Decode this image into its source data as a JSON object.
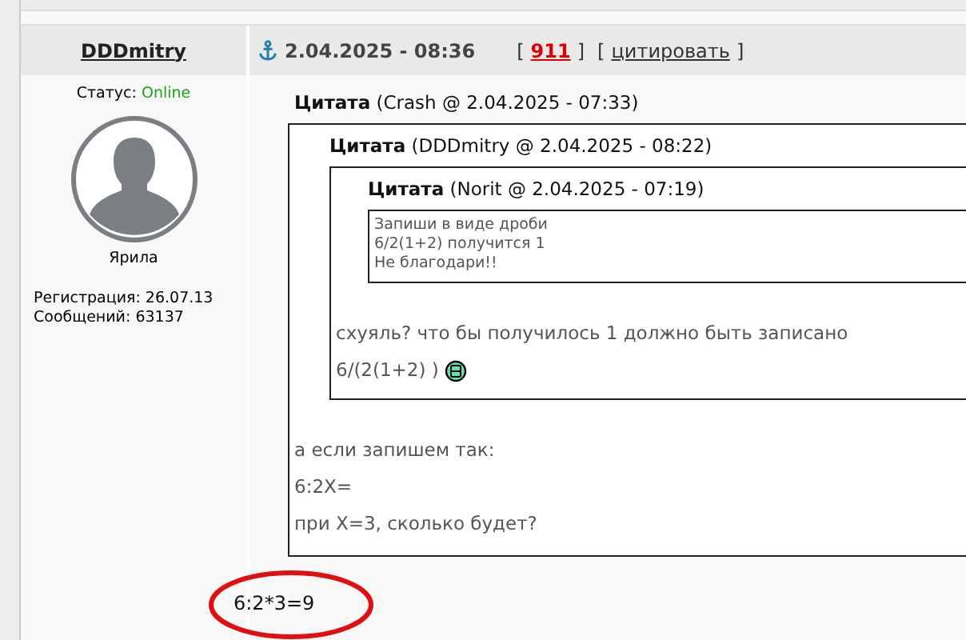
{
  "post": {
    "author": "DDDmitry",
    "date": "2.04.2025 - 08:36",
    "post_number": "911",
    "bracket_open": "[",
    "bracket_close": "]",
    "quote_link": "цитировать",
    "profile": {
      "status_label": "Статус:",
      "status": "Online",
      "name": "Ярила",
      "registration": "Регистрация: 26.07.13",
      "messages": "Сообщений: 63137"
    },
    "quote": {
      "label": "Цитата",
      "source": "(Crash @ 2.04.2025 - 07:33)",
      "quote": {
        "label": "Цитата",
        "source": "(DDDmitry @ 2.04.2025 - 08:22)",
        "quote": {
          "label": "Цитата",
          "source": "(Norit @ 2.04.2025 - 07:19)",
          "lines": [
            "Запиши в виде дроби",
            "6/2(1+2) получится 1",
            "Не благодари!!"
          ]
        },
        "lines": [
          "схуяль? что бы получилось 1 должно быть записано",
          "6/(2(1+2) )"
        ]
      },
      "lines": [
        "а если запишем так:",
        "6:2X=",
        "при X=3, сколько будет?"
      ]
    },
    "text": "6:2*3=9"
  }
}
